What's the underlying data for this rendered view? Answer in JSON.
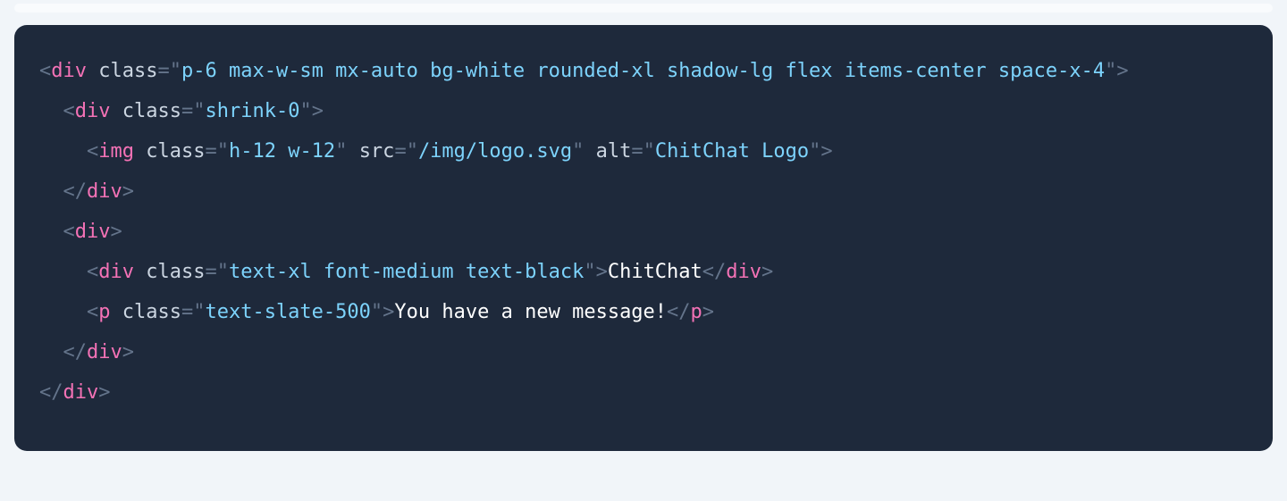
{
  "code": {
    "lines": [
      {
        "indent": 0,
        "open": true,
        "tag": "div",
        "attrs": [
          {
            "name": "class",
            "value": "p-6 max-w-sm mx-auto bg-white rounded-xl shadow-lg flex items-center space-x-4"
          }
        ]
      },
      {
        "indent": 1,
        "open": true,
        "tag": "div",
        "attrs": [
          {
            "name": "class",
            "value": "shrink-0"
          }
        ]
      },
      {
        "indent": 2,
        "self": true,
        "tag": "img",
        "attrs": [
          {
            "name": "class",
            "value": "h-12 w-12"
          },
          {
            "name": "src",
            "value": "/img/logo.svg"
          },
          {
            "name": "alt",
            "value": "ChitChat Logo"
          }
        ]
      },
      {
        "indent": 1,
        "close": true,
        "tag": "div"
      },
      {
        "indent": 1,
        "open": true,
        "tag": "div",
        "attrs": []
      },
      {
        "indent": 2,
        "inline": true,
        "tag": "div",
        "attrs": [
          {
            "name": "class",
            "value": "text-xl font-medium text-black"
          }
        ],
        "text": "ChitChat"
      },
      {
        "indent": 2,
        "inline": true,
        "tag": "p",
        "attrs": [
          {
            "name": "class",
            "value": "text-slate-500"
          }
        ],
        "text": "You have a new message!"
      },
      {
        "indent": 1,
        "close": true,
        "tag": "div"
      },
      {
        "indent": 0,
        "close": true,
        "tag": "div"
      }
    ]
  }
}
